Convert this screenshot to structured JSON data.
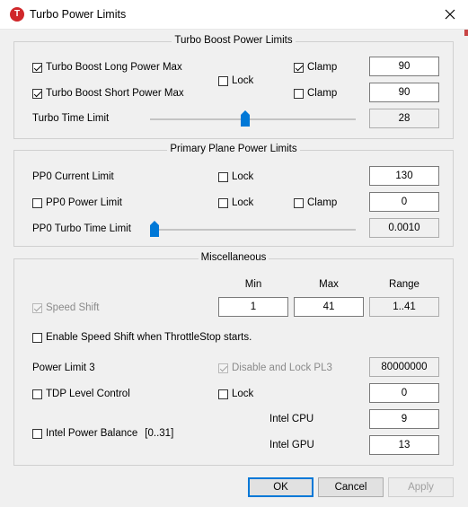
{
  "window": {
    "title": "Turbo Power Limits"
  },
  "turbo": {
    "legend": "Turbo Boost Power Limits",
    "long": {
      "label": "Turbo Boost Long Power Max",
      "checked": true,
      "clamp_label": "Clamp",
      "clamp": true,
      "value": "90"
    },
    "short": {
      "label": "Turbo Boost Short Power Max",
      "checked": true,
      "clamp_label": "Clamp",
      "clamp": false,
      "value": "90"
    },
    "lock_label": "Lock",
    "time_label": "Turbo Time Limit",
    "time_value": "28",
    "time_slider_fraction": 0.46
  },
  "primary": {
    "legend": "Primary Plane Power Limits",
    "current_label": "PP0 Current Limit",
    "current_lock_label": "Lock",
    "current_value": "130",
    "power_label": "PP0 Power Limit",
    "power_lock_label": "Lock",
    "power_clamp_label": "Clamp",
    "power_value": "0",
    "turbo_time_label": "PP0 Turbo Time Limit",
    "turbo_time_value": "0.0010",
    "turbo_time_slider_fraction": 0.0
  },
  "misc": {
    "legend": "Miscellaneous",
    "col_min": "Min",
    "col_max": "Max",
    "col_range": "Range",
    "speed_shift_label": "Speed Shift",
    "min_value": "1",
    "max_value": "41",
    "range_value": "1..41",
    "enable_speed_shift_label": "Enable Speed Shift when ThrottleStop starts.",
    "power_limit3_label": "Power Limit 3",
    "disable_lock_pl3_label": "Disable and Lock PL3",
    "pl3_value": "80000000",
    "tdp_label": "TDP Level Control",
    "tdp_lock_label": "Lock",
    "tdp_value": "0",
    "intel_power_balance_label": "Intel Power Balance",
    "intel_power_balance_range": "[0..31]",
    "intel_cpu_label": "Intel CPU",
    "intel_cpu_value": "9",
    "intel_gpu_label": "Intel GPU",
    "intel_gpu_value": "13"
  },
  "buttons": {
    "ok": "OK",
    "cancel": "Cancel",
    "apply": "Apply"
  }
}
